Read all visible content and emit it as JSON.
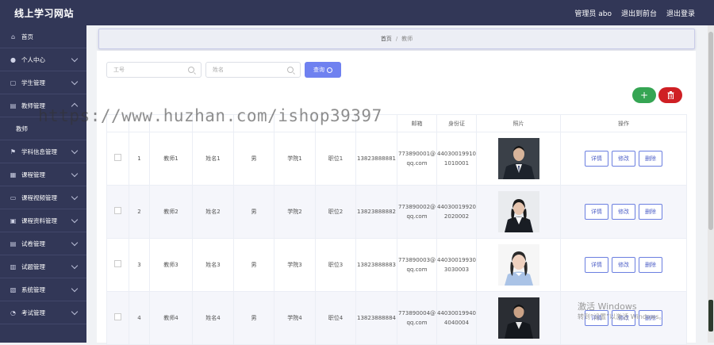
{
  "app": {
    "title": "线上学习网站"
  },
  "header": {
    "admin": "管理员 abo",
    "front": "退出到前台",
    "logout": "退出登录"
  },
  "sidebar": {
    "items": [
      {
        "label": "首页",
        "icon": "home-icon",
        "glyph": "⌂",
        "chevron": false
      },
      {
        "label": "个人中心",
        "icon": "user-icon",
        "glyph": "●",
        "chevron": true
      },
      {
        "label": "学生管理",
        "icon": "student-icon",
        "glyph": "▢",
        "chevron": true
      },
      {
        "label": "教师管理",
        "icon": "teacher-icon",
        "glyph": "▤",
        "chevron": true,
        "open": true
      },
      {
        "label": "学科信息管理",
        "icon": "subject-icon",
        "glyph": "⚑",
        "chevron": true
      },
      {
        "label": "课程管理",
        "icon": "course-icon",
        "glyph": "▦",
        "chevron": true
      },
      {
        "label": "课程视频管理",
        "icon": "video-icon",
        "glyph": "▭",
        "chevron": true
      },
      {
        "label": "课程资料管理",
        "icon": "material-icon",
        "glyph": "▣",
        "chevron": true
      },
      {
        "label": "试卷管理",
        "icon": "exam-paper-icon",
        "glyph": "▤",
        "chevron": true
      },
      {
        "label": "试题管理",
        "icon": "question-icon",
        "glyph": "▥",
        "chevron": true
      },
      {
        "label": "系统管理",
        "icon": "system-icon",
        "glyph": "▧",
        "chevron": true
      },
      {
        "label": "考试管理",
        "icon": "exam-icon",
        "glyph": "◔",
        "chevron": true
      }
    ],
    "submenu": "教师"
  },
  "breadcrumb": {
    "home": "首页",
    "sep": "/",
    "current": "教师"
  },
  "search": {
    "field1_placeholder": "工号",
    "field2_placeholder": "姓名",
    "query_label": "查询"
  },
  "actions": {
    "add_label": "+",
    "delete_label": "🗑"
  },
  "table": {
    "headers": [
      "",
      "",
      "",
      "",
      "",
      "",
      "",
      "",
      "邮箱",
      "身份证",
      "照片",
      "操作"
    ],
    "rows": [
      {
        "index": "1",
        "teacher": "教师1",
        "name": "姓名1",
        "gender": "男",
        "college": "学院1",
        "position": "职位1",
        "phone": "13823888881",
        "email": "773890001@qq.com",
        "idcard": "440300199101010001"
      },
      {
        "index": "2",
        "teacher": "教师2",
        "name": "姓名2",
        "gender": "男",
        "college": "学院2",
        "position": "职位2",
        "phone": "13823888882",
        "email": "773890002@qq.com",
        "idcard": "440300199202020002"
      },
      {
        "index": "3",
        "teacher": "教师3",
        "name": "姓名3",
        "gender": "男",
        "college": "学院3",
        "position": "职位3",
        "phone": "13823888883",
        "email": "773890003@qq.com",
        "idcard": "440300199303030003"
      },
      {
        "index": "4",
        "teacher": "教师4",
        "name": "姓名4",
        "gender": "男",
        "college": "学院4",
        "position": "职位4",
        "phone": "13823888884",
        "email": "773890004@qq.com",
        "idcard": "440300199404040004"
      }
    ],
    "ops": {
      "detail": "详情",
      "edit": "修改",
      "delete": "删除"
    }
  },
  "watermark": "https://www.huzhan.com/ishop39397",
  "activation": {
    "title": "激活 Windows",
    "sub": "转到“设置”以激活 Windows。"
  },
  "colors": {
    "nav": "#323757",
    "primary": "#6f81f0",
    "success": "#35a553",
    "danger": "#cf1f24"
  }
}
